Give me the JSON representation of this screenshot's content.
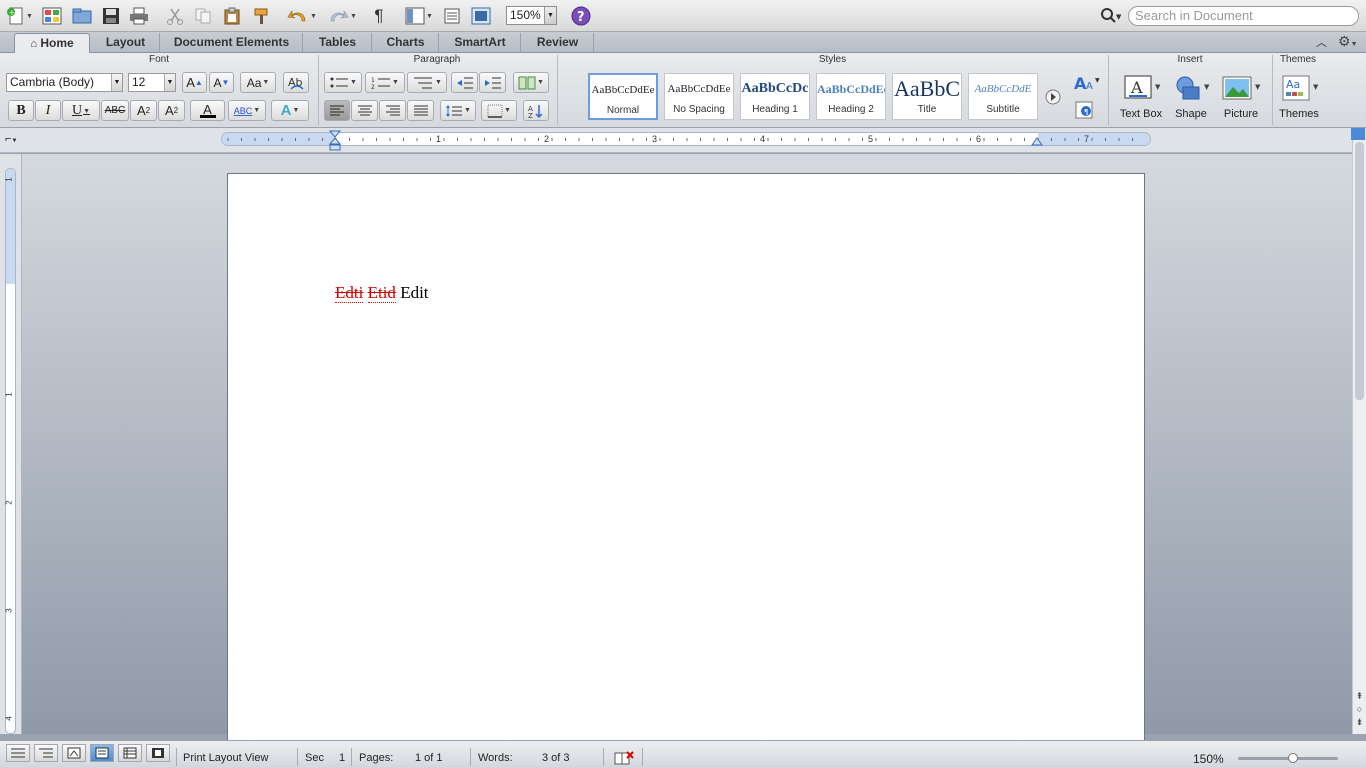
{
  "toolbar": {
    "zoom": "150%",
    "search_placeholder": "Search in Document"
  },
  "tabs": [
    {
      "label": "Home"
    },
    {
      "label": "Layout"
    },
    {
      "label": "Document Elements"
    },
    {
      "label": "Tables"
    },
    {
      "label": "Charts"
    },
    {
      "label": "SmartArt"
    },
    {
      "label": "Review"
    }
  ],
  "ribbon": {
    "groups": {
      "font": "Font",
      "paragraph": "Paragraph",
      "styles": "Styles",
      "insert": "Insert",
      "themes": "Themes"
    },
    "font_name": "Cambria (Body)",
    "font_size": "12",
    "bold": "B",
    "italic": "I",
    "underline": "U",
    "strike": "ABC",
    "superscript": "A",
    "subscript": "A",
    "grow": "A",
    "shrink": "A",
    "change_case": "Aa",
    "highlight_sample": "ABC",
    "text_color": "A",
    "effects": "A",
    "styles": [
      {
        "sample": "AaBbCcDdEe",
        "label": "Normal"
      },
      {
        "sample": "AaBbCcDdEe",
        "label": "No Spacing"
      },
      {
        "sample": "AaBbCcDc",
        "label": "Heading 1"
      },
      {
        "sample": "AaBbCcDdEe",
        "label": "Heading 2"
      },
      {
        "sample": "AaBbC",
        "label": "Title"
      },
      {
        "sample": "AaBbCcDdE",
        "label": "Subtitle"
      }
    ],
    "insert": [
      {
        "label": "Text Box"
      },
      {
        "label": "Shape"
      },
      {
        "label": "Picture"
      }
    ],
    "themes_label": "Themes",
    "themes_sample": "Aa"
  },
  "ruler": {
    "numbers": [
      "1",
      "2",
      "3",
      "4",
      "5",
      "6",
      "7"
    ],
    "vnumbers": [
      "1",
      "1",
      "2",
      "3",
      "4"
    ]
  },
  "document": {
    "deleted_1": "Edti",
    "deleted_2": "Etid",
    "inserted": "Edit"
  },
  "status": {
    "view_name": "Print Layout View",
    "sec_label": "Sec",
    "sec_value": "1",
    "pages_label": "Pages:",
    "pages_value": "1 of 1",
    "words_label": "Words:",
    "words_value": "3 of 3",
    "zoom": "150%"
  },
  "colors": {
    "accent_blue": "#4b8ad8",
    "tracked_red": "#d00000",
    "heading_blue": "#1f497d"
  }
}
